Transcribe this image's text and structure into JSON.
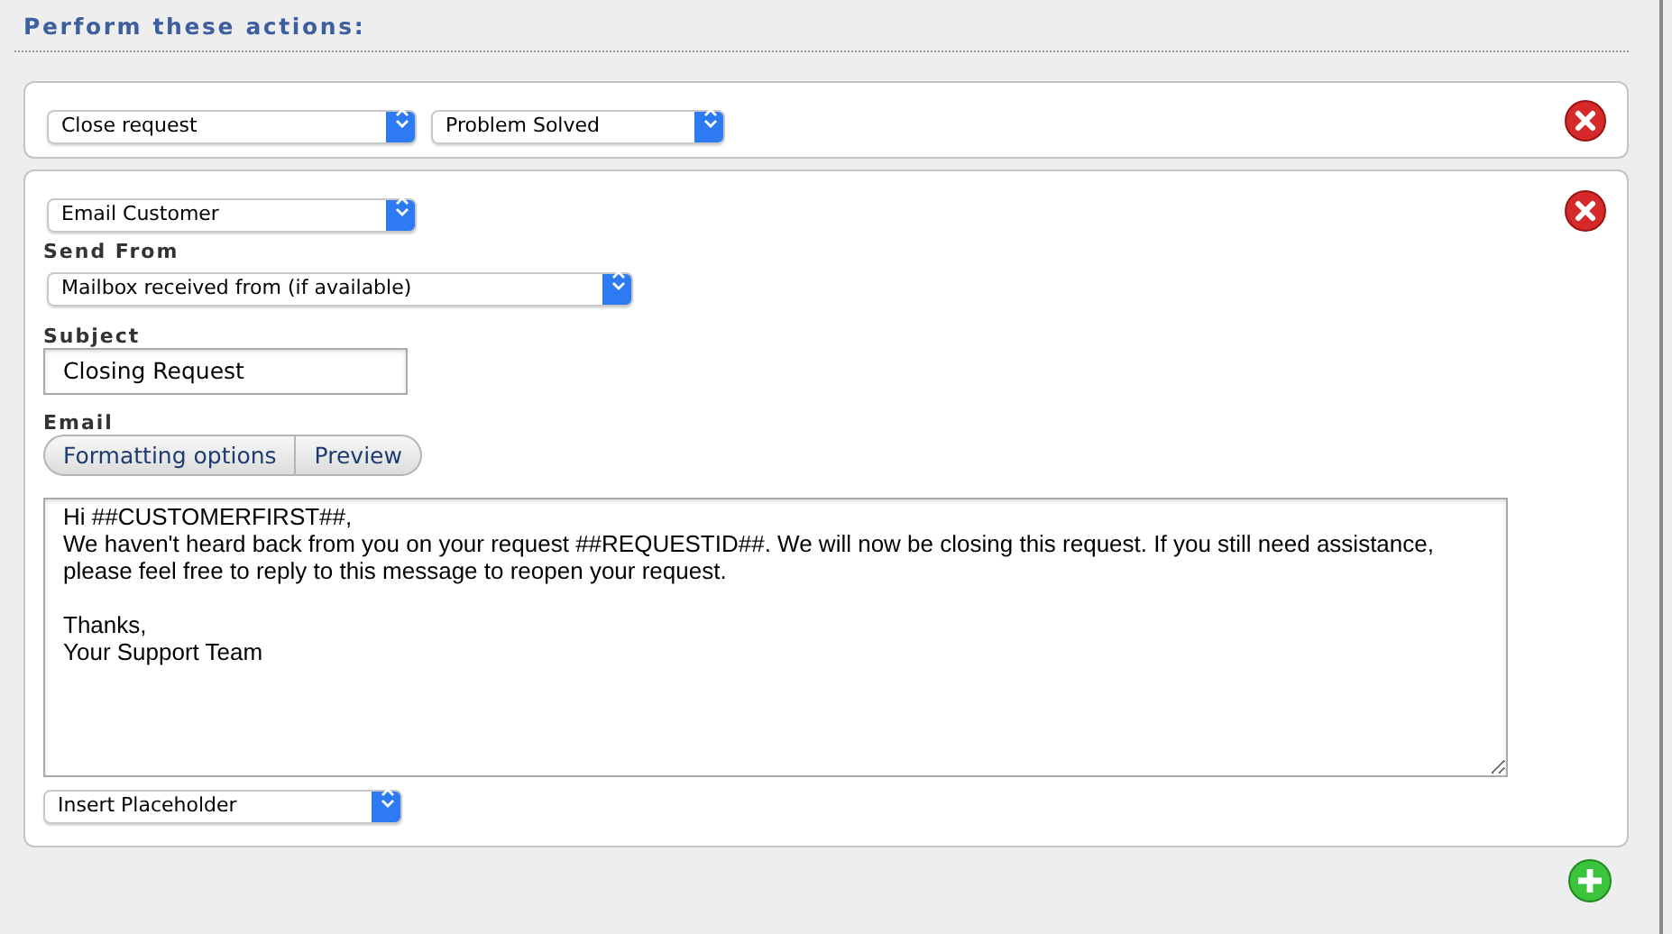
{
  "heading": "Perform these actions:",
  "actions": [
    {
      "kind": "simple",
      "selects": [
        {
          "value": "Close request"
        },
        {
          "value": "Problem Solved"
        }
      ]
    },
    {
      "kind": "email",
      "action_select": "Email Customer",
      "send_from_label": "Send From",
      "send_from": "Mailbox received from (if available)",
      "subject_label": "Subject",
      "subject": "Closing Request",
      "email_label": "Email",
      "editor_buttons": [
        "Formatting options",
        "Preview"
      ],
      "body": "Hi ##CUSTOMERFIRST##,\nWe haven't heard back from you on your request ##REQUESTID##. We will now be closing this request. If you still need assistance,\nplease feel free to reply to this message to reopen your request.\n\nThanks,\nYour Support Team",
      "placeholder_select": "Insert Placeholder"
    }
  ]
}
